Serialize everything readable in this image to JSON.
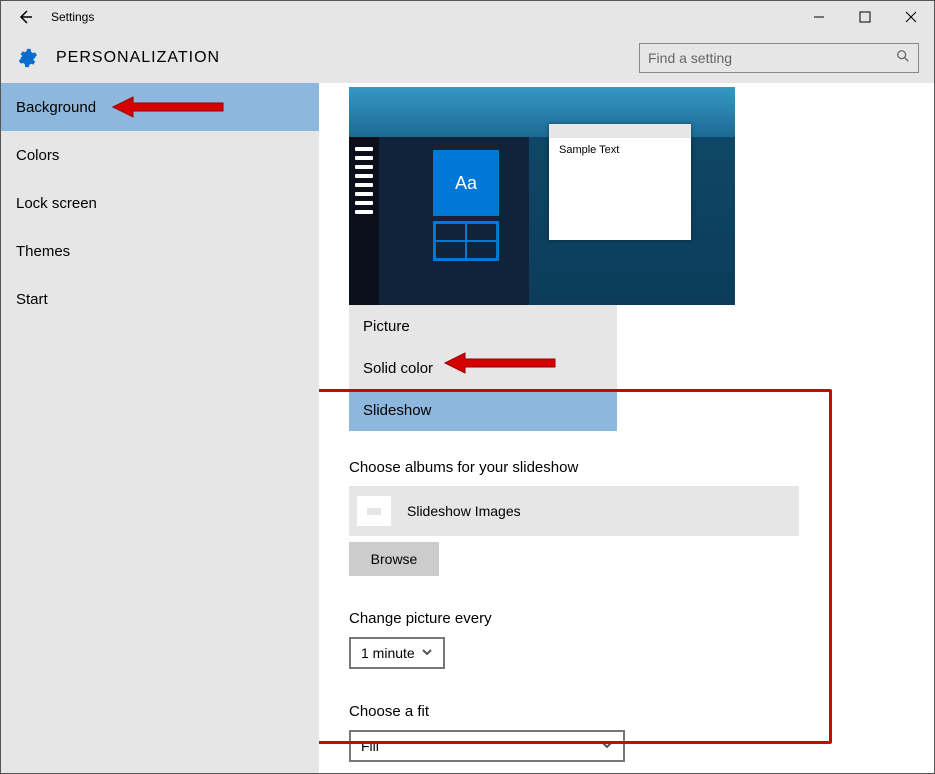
{
  "window": {
    "title": "Settings"
  },
  "search": {
    "placeholder": "Find a setting"
  },
  "page": {
    "title": "PERSONALIZATION"
  },
  "sidebar": {
    "items": [
      {
        "label": "Background",
        "selected": true
      },
      {
        "label": "Colors"
      },
      {
        "label": "Lock screen"
      },
      {
        "label": "Themes"
      },
      {
        "label": "Start"
      }
    ]
  },
  "preview": {
    "tile_text": "Aa",
    "sample_window_text": "Sample Text"
  },
  "background_dropdown": {
    "options": [
      {
        "label": "Picture"
      },
      {
        "label": "Solid color"
      },
      {
        "label": "Slideshow",
        "selected": true
      }
    ]
  },
  "slideshow": {
    "albums_label": "Choose albums for your slideshow",
    "album_name": "Slideshow Images",
    "browse_label": "Browse",
    "interval_label": "Change picture every",
    "interval_value": "1 minute",
    "fit_label": "Choose a fit",
    "fit_value": "Fill"
  }
}
